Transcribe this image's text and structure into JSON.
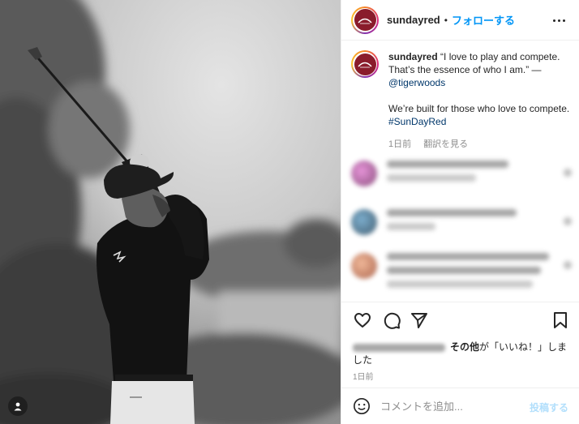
{
  "account": {
    "username": "sundayred",
    "separator": "•",
    "follow_label": "フォローする",
    "more_icon": "more-horizontal-icon"
  },
  "caption": {
    "username": "sundayred",
    "quote": "“I love to play and compete. That’s the essence of who I am.” — ",
    "mention": "@tigerwoods",
    "line2": "We’re built for those who love to compete. ",
    "hashtag": "#SunDayRed",
    "time": "1日前",
    "translate_label": "翻訳を見る"
  },
  "comments_note": "blurred",
  "actions": {
    "like_icon": "heart-icon",
    "comment_icon": "comment-bubble-icon",
    "share_icon": "paper-plane-icon",
    "save_icon": "bookmark-icon"
  },
  "likes": {
    "others_label": "その他",
    "suffix": "が「いいね！」しました"
  },
  "post_time": "1日前",
  "comment_box": {
    "placeholder": "コメントを追加...",
    "post_label": "投稿する",
    "emoji_icon": "smiley-icon"
  },
  "colors": {
    "brand_accent": "#8a1c2b",
    "follow_blue": "#0095f6",
    "link_blue": "#00376b",
    "muted_gray": "#8e8e8e",
    "post_disabled": "#b2dffc"
  }
}
